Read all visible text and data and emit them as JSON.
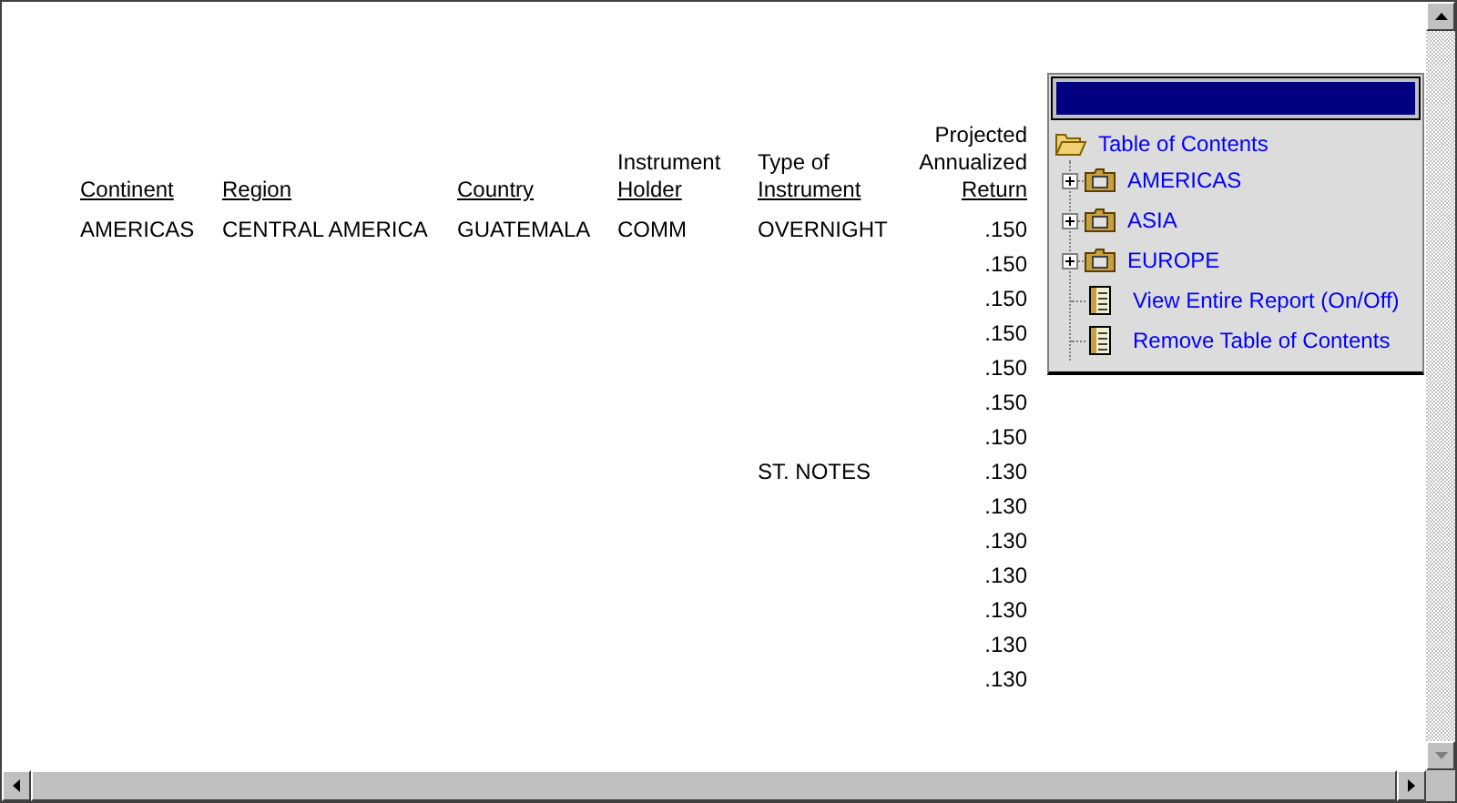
{
  "report": {
    "columns": [
      {
        "label_lines": [
          "Continent"
        ],
        "kind": "text"
      },
      {
        "label_lines": [
          "Region"
        ],
        "kind": "text"
      },
      {
        "label_lines": [
          "Country"
        ],
        "kind": "text"
      },
      {
        "label_lines": [
          "Instrument",
          "Holder"
        ],
        "kind": "text"
      },
      {
        "label_lines": [
          "Type of",
          "Instrument"
        ],
        "kind": "text"
      },
      {
        "label_lines": [
          "Projected",
          "Annualized",
          "Return"
        ],
        "kind": "number"
      }
    ],
    "rows": [
      [
        "AMERICAS",
        "CENTRAL AMERICA",
        "GUATEMALA",
        "COMM",
        "OVERNIGHT",
        ".150"
      ],
      [
        "",
        "",
        "",
        "",
        "",
        ".150"
      ],
      [
        "",
        "",
        "",
        "",
        "",
        ".150"
      ],
      [
        "",
        "",
        "",
        "",
        "",
        ".150"
      ],
      [
        "",
        "",
        "",
        "",
        "",
        ".150"
      ],
      [
        "",
        "",
        "",
        "",
        "",
        ".150"
      ],
      [
        "",
        "",
        "",
        "",
        "",
        ".150"
      ],
      [
        "",
        "",
        "",
        "",
        "ST. NOTES",
        ".130"
      ],
      [
        "",
        "",
        "",
        "",
        "",
        ".130"
      ],
      [
        "",
        "",
        "",
        "",
        "",
        ".130"
      ],
      [
        "",
        "",
        "",
        "",
        "",
        ".130"
      ],
      [
        "",
        "",
        "",
        "",
        "",
        ".130"
      ],
      [
        "",
        "",
        "",
        "",
        "",
        ".130"
      ],
      [
        "",
        "",
        "",
        "",
        "",
        ".130"
      ]
    ]
  },
  "toc": {
    "root": "Table of Contents",
    "items": [
      {
        "kind": "folder",
        "label": "AMERICAS",
        "expanded": false
      },
      {
        "kind": "folder",
        "label": "ASIA",
        "expanded": false
      },
      {
        "kind": "folder",
        "label": "EUROPE",
        "expanded": false
      },
      {
        "kind": "action",
        "label": "View Entire Report (On/Off)"
      },
      {
        "kind": "action",
        "label": "Remove Table of Contents"
      }
    ]
  }
}
